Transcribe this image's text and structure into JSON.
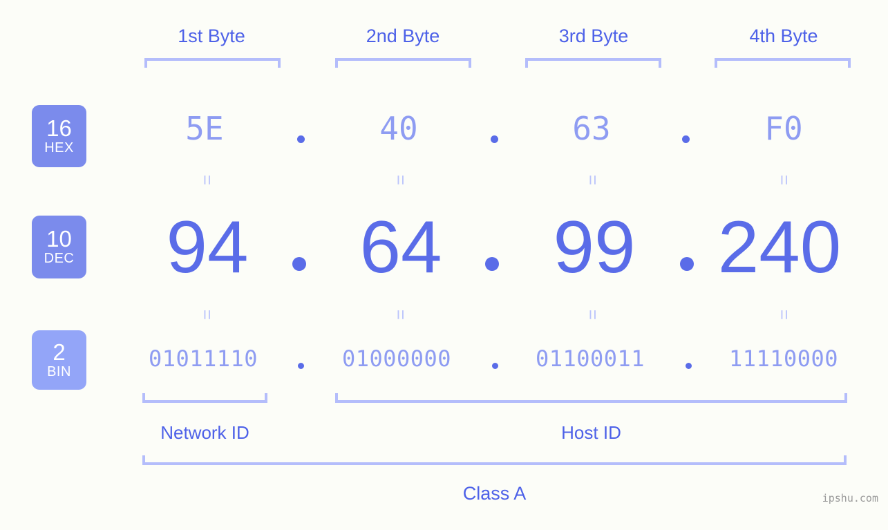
{
  "bg_color": "#fcfdf8",
  "accent": {
    "header_blue": "#4d61e8",
    "bracket_blue": "#b4bdfb",
    "badge_blue": "#7b8bec",
    "badge_blue_light": "#93a5f8",
    "value_blue_light": "#8e9cf2",
    "value_blue_strong": "#5a6ce8",
    "equals_blue": "#bcc5fb",
    "watermark_gray": "#9a9a9a"
  },
  "byte_headers": [
    {
      "label": "1st Byte"
    },
    {
      "label": "2nd Byte"
    },
    {
      "label": "3rd Byte"
    },
    {
      "label": "4th Byte"
    }
  ],
  "bases": [
    {
      "number": "16",
      "name": "HEX"
    },
    {
      "number": "10",
      "name": "DEC"
    },
    {
      "number": "2",
      "name": "BIN"
    }
  ],
  "rows": {
    "hex": {
      "values": [
        "5E",
        "40",
        "63",
        "F0"
      ],
      "separator": "."
    },
    "dec": {
      "values": [
        "94",
        "64",
        "99",
        "240"
      ],
      "separator": "."
    },
    "bin": {
      "values": [
        "01011110",
        "01000000",
        "01100011",
        "11110000"
      ],
      "separator": "."
    }
  },
  "equals_symbol": "=",
  "segments": [
    {
      "label": "Network ID"
    },
    {
      "label": "Host ID"
    }
  ],
  "class": {
    "label": "Class A"
  },
  "watermark": {
    "text": "ipshu.com"
  }
}
